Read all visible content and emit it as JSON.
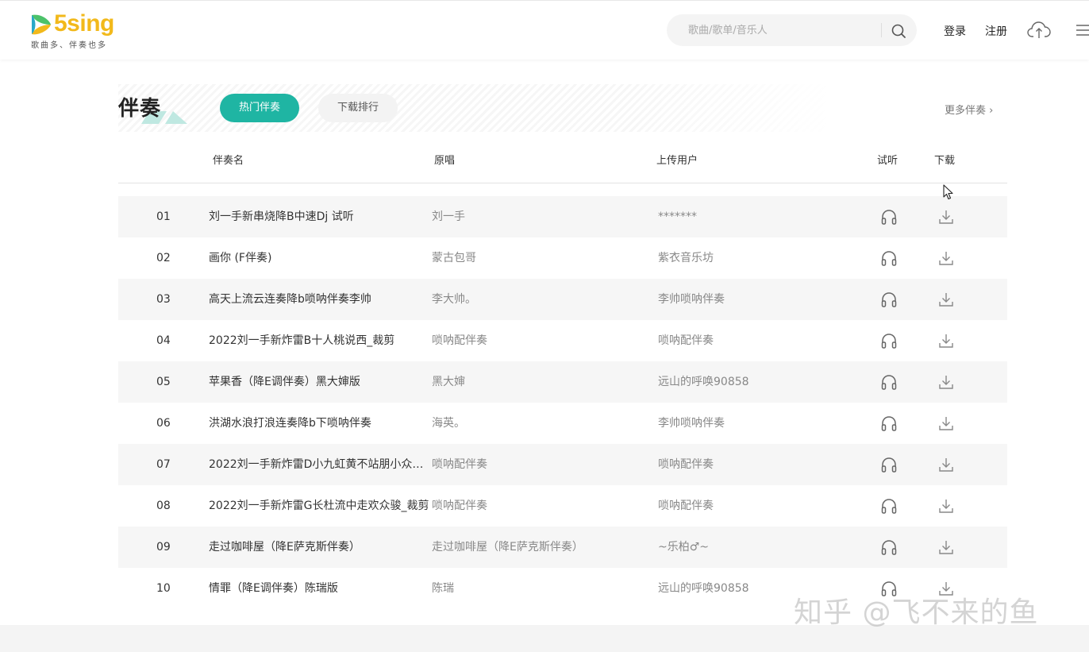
{
  "logo": {
    "word": "5sing",
    "tagline": "歌曲多、伴奏也多"
  },
  "search": {
    "placeholder": "歌曲/歌单/音乐人"
  },
  "nav": {
    "login": "登录",
    "register": "注册"
  },
  "section": {
    "title": "伴奏",
    "tabs": [
      {
        "label": "热门伴奏",
        "active": true
      },
      {
        "label": "下载排行",
        "active": false
      }
    ],
    "more_label": "更多伴奏 ›"
  },
  "table": {
    "headers": {
      "name": "伴奏名",
      "singer": "原唱",
      "uploader": "上传用户",
      "listen": "试听",
      "download": "下载"
    },
    "rows": [
      {
        "num": "01",
        "name": "刘一手新串烧降B中速Dj 试听",
        "singer": "刘一手",
        "uploader": "*******"
      },
      {
        "num": "02",
        "name": "画你 (F伴奏)",
        "singer": "蒙古包哥",
        "uploader": "紫衣音乐坊"
      },
      {
        "num": "03",
        "name": "高天上流云连奏降b唢呐伴奏李帅",
        "singer": "李大帅。",
        "uploader": "李帅唢呐伴奏"
      },
      {
        "num": "04",
        "name": "2022刘一手新炸雷B十人桃说西_裁剪",
        "singer": "唢呐配伴奏",
        "uploader": "唢呐配伴奏"
      },
      {
        "num": "05",
        "name": "苹果香（降E调伴奏）黑大婶版",
        "singer": "黑大婶",
        "uploader": "远山的呼唤90858"
      },
      {
        "num": "06",
        "name": "洪湖水浪打浪连奏降b下唢呐伴奏",
        "singer": "海英。",
        "uploader": "李帅唢呐伴奏"
      },
      {
        "num": "07",
        "name": "2022刘一手新炸雷D小九虹黄不站朋小众骏...",
        "singer": "唢呐配伴奏",
        "uploader": "唢呐配伴奏"
      },
      {
        "num": "08",
        "name": "2022刘一手新炸雷G长杜流中走欢众骏_裁剪",
        "singer": "唢呐配伴奏",
        "uploader": "唢呐配伴奏"
      },
      {
        "num": "09",
        "name": "走过咖啡屋（降E萨克斯伴奏）",
        "singer": "走过咖啡屋（降E萨克斯伴奏）",
        "uploader": "~乐柏♂~"
      },
      {
        "num": "10",
        "name": "情罪（降E调伴奏）陈瑞版",
        "singer": "陈瑞",
        "uploader": "远山的呼唤90858"
      }
    ]
  },
  "watermark": "知乎 @飞不来的鱼",
  "colors": {
    "accent": "#1fb5a3",
    "logo_yellow": "#f2b91b",
    "logo_green": "#4cc26a"
  }
}
